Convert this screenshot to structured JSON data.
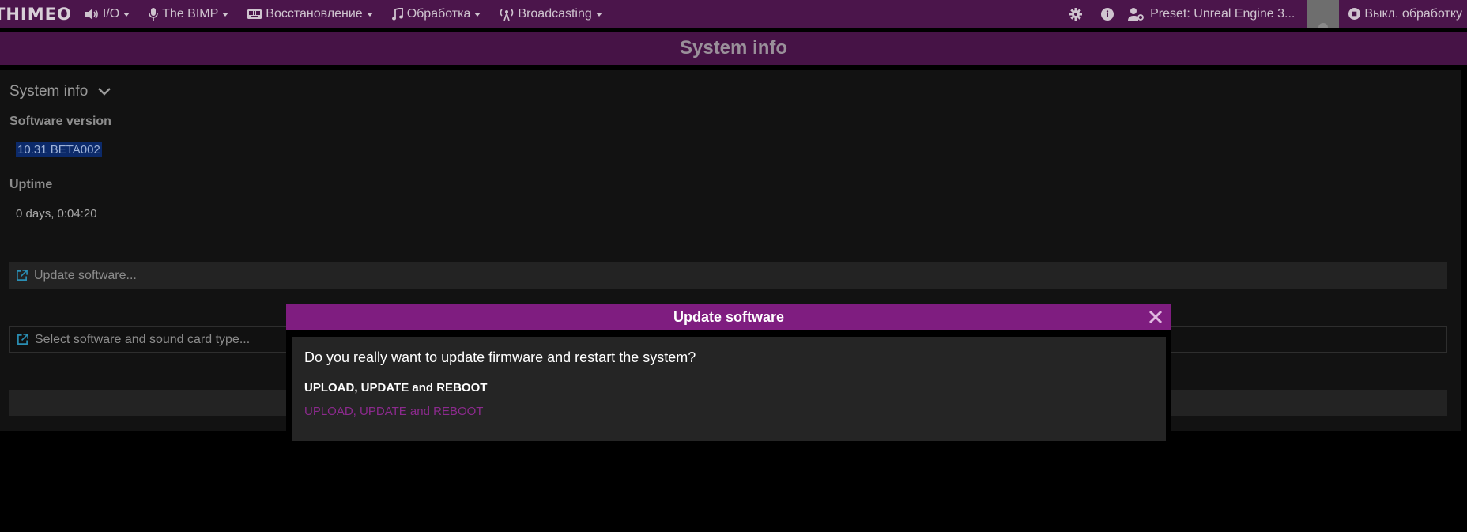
{
  "navbar": {
    "brand": "THIMEO",
    "menus": [
      {
        "label": "I/O",
        "icon": "speaker-icon"
      },
      {
        "label": "The BIMP",
        "icon": "microphone-icon"
      },
      {
        "label": "Восстановление",
        "icon": "keyboard-icon"
      },
      {
        "label": "Обработка",
        "icon": "music-note-icon"
      },
      {
        "label": "Broadcasting",
        "icon": "broadcast-tower-icon"
      }
    ],
    "preset_label": "Preset: Unreal Engine 3...",
    "stop_label": "Выкл. обработку"
  },
  "page": {
    "title": "System info"
  },
  "system_info": {
    "section_title": "System info",
    "software_version_label": "Software version",
    "software_version_value": "10.31 BETA002",
    "uptime_label": "Uptime",
    "uptime_value": "0 days, 0:04:20",
    "update_software_label": "Update software...",
    "select_software_label": "Select software and sound card type..."
  },
  "modal": {
    "title": "Update software",
    "question": "Do you really want to update firmware and restart the system?",
    "subtitle": "UPLOAD, UPDATE and REBOOT",
    "link_label": "UPLOAD, UPDATE and REBOOT"
  },
  "colors": {
    "navbar_bg": "#4b154b",
    "header_bg": "#461346",
    "modal_header_bg": "#7f1d80",
    "link_color": "#8c2a8e",
    "external_icon_color": "#2a8fb5"
  }
}
